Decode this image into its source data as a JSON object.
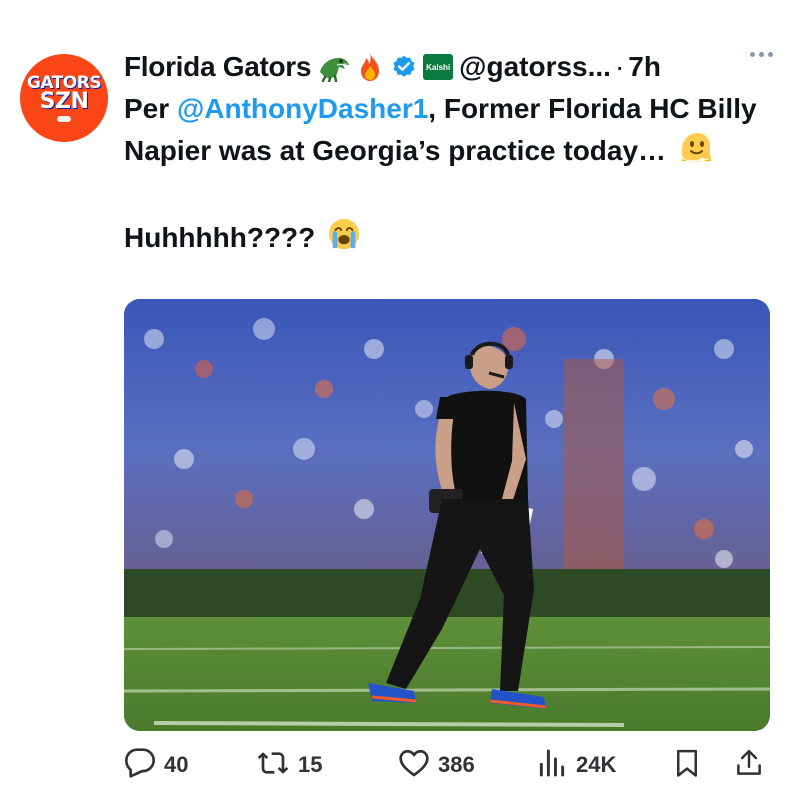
{
  "tweet": {
    "author": {
      "avatar_text_top": "GATORS",
      "avatar_text_bottom": "SZN",
      "display_name": "Florida Gators",
      "name_emojis": [
        "gator-emoji",
        "fire-emoji"
      ],
      "verified": true,
      "badge_label": "Kalshi",
      "handle": "@gatorss...",
      "separator": "·",
      "time": "7h"
    },
    "text": {
      "prefix": "Per ",
      "mention": "@AnthonyDasher1",
      "line_rest": ", Former Florida HC Billy Napier was at Georgia’s practice today…",
      "emoji_1": "melting-face",
      "second_paragraph": "Huhhhhh????",
      "emoji_2": "loudly-crying-face"
    },
    "media": {
      "kind": "photo",
      "subject": "coach-on-sideline"
    },
    "metrics": {
      "replies": "40",
      "reposts": "15",
      "likes": "386",
      "views": "24K"
    }
  },
  "colors": {
    "accent": "#1d9bf0",
    "brand_orange": "#fa4616",
    "brand_blue": "#0021a5",
    "text": "#0f1419",
    "icon": "#2f3336"
  },
  "icons": {
    "more": "more-icon",
    "reply": "reply-icon",
    "repost": "repost-icon",
    "like": "heart-icon",
    "views": "views-icon",
    "bookmark": "bookmark-icon",
    "share": "share-icon"
  }
}
